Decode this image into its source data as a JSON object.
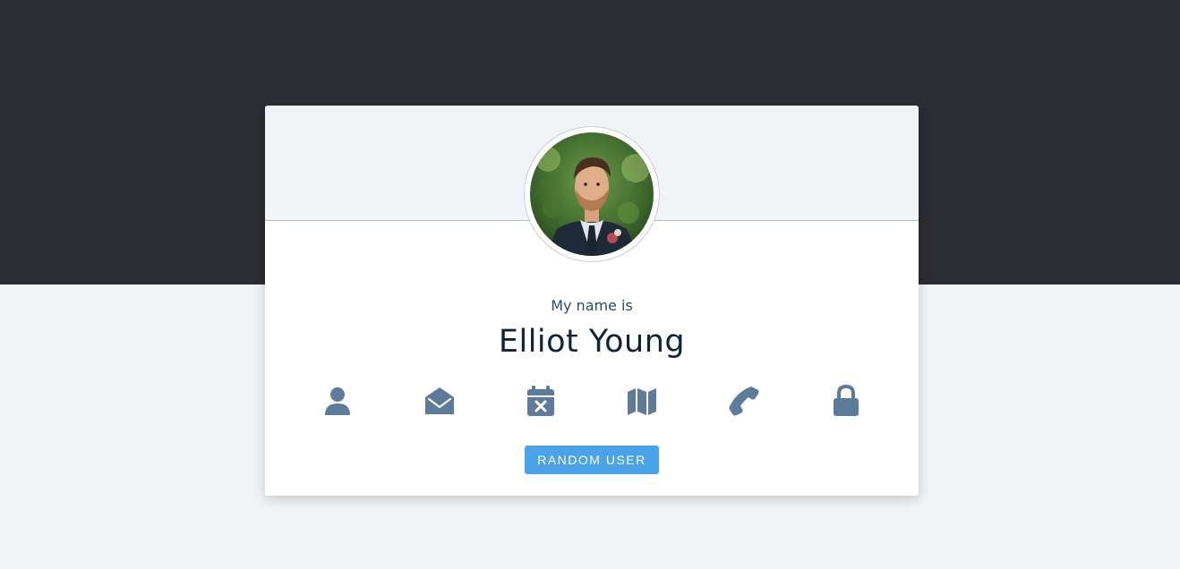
{
  "profile": {
    "label": "My name is",
    "value": "Elliot Young"
  },
  "icons": [
    {
      "name": "user-icon"
    },
    {
      "name": "envelope-open-icon"
    },
    {
      "name": "calendar-x-icon"
    },
    {
      "name": "map-icon"
    },
    {
      "name": "phone-icon"
    },
    {
      "name": "lock-icon"
    }
  ],
  "button": {
    "label": "RANDOM USER"
  },
  "colors": {
    "top_band": "#2c2d32",
    "page_bg": "#f0f4f7",
    "icon": "#5d7c9c",
    "button": "#4aa3e8",
    "name_text": "#0f2439"
  }
}
